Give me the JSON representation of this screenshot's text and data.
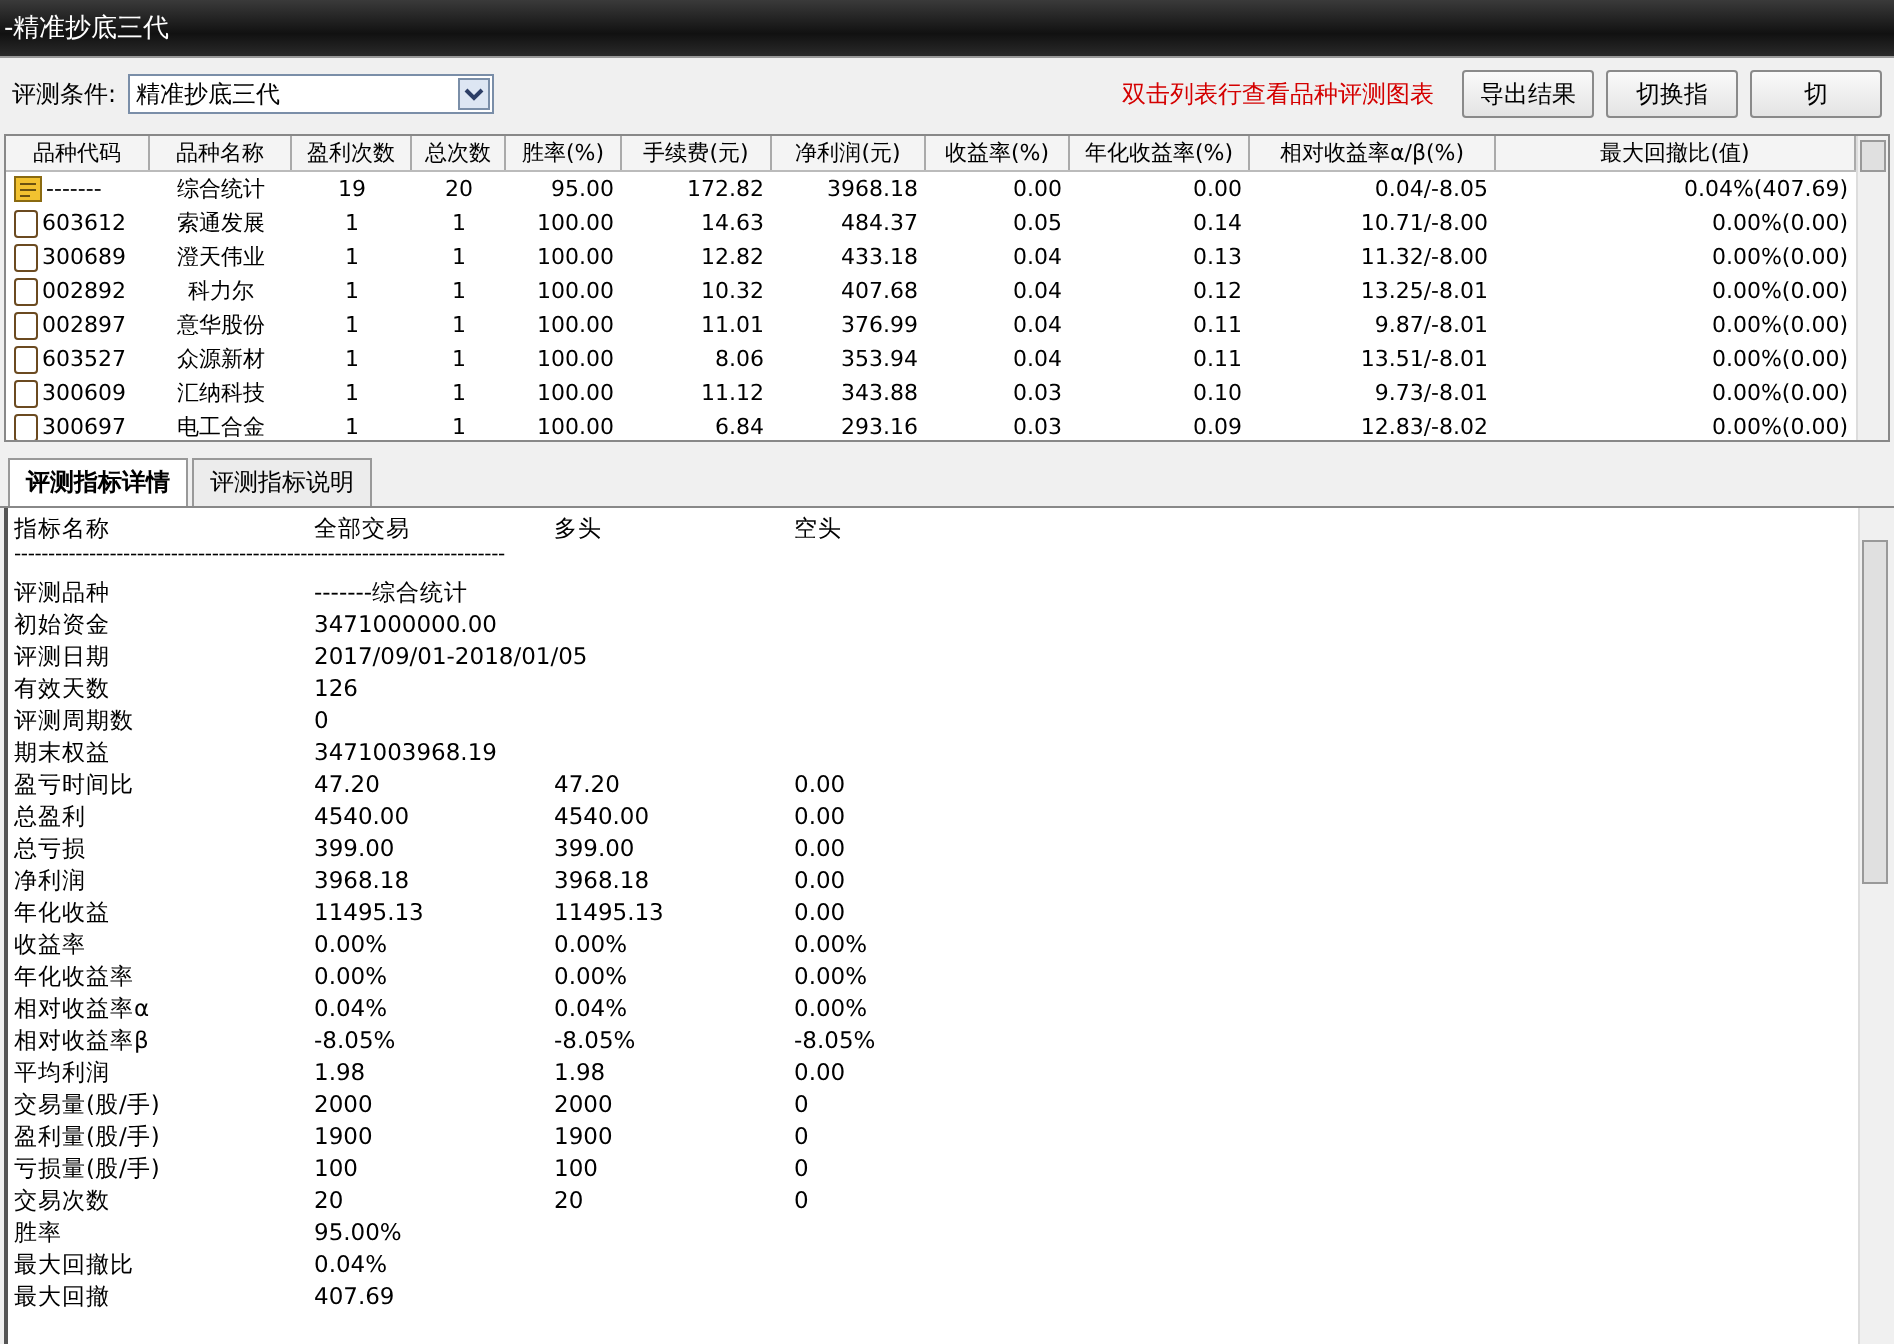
{
  "window": {
    "title": "-精准抄底三代"
  },
  "toolbar": {
    "condition_label": "评测条件:",
    "condition_value": "精准抄底三代",
    "hint": "双击列表行查看品种评测图表",
    "buttons": [
      {
        "label": "导出结果"
      },
      {
        "label": "切换指"
      },
      {
        "label": "切"
      }
    ]
  },
  "table": {
    "columns": [
      "品种代码",
      "品种名称",
      "盈利次数",
      "总次数",
      "胜率(%)",
      "手续费(元)",
      "净利润(元)",
      "收益率(%)",
      "年化收益率(%)",
      "相对收益率α/β(%)",
      "最大回撤比(值)"
    ],
    "rows": [
      {
        "kind": "summary",
        "cells": [
          "-------",
          "综合统计",
          "19",
          "20",
          "95.00",
          "172.82",
          "3968.18",
          "0.00",
          "0.00",
          "0.04/-8.05",
          "0.04%(407.69)"
        ]
      },
      {
        "kind": "item",
        "cells": [
          "603612",
          "索通发展",
          "1",
          "1",
          "100.00",
          "14.63",
          "484.37",
          "0.05",
          "0.14",
          "10.71/-8.00",
          "0.00%(0.00)"
        ]
      },
      {
        "kind": "item",
        "cells": [
          "300689",
          "澄天伟业",
          "1",
          "1",
          "100.00",
          "12.82",
          "433.18",
          "0.04",
          "0.13",
          "11.32/-8.00",
          "0.00%(0.00)"
        ]
      },
      {
        "kind": "item",
        "cells": [
          "002892",
          "科力尔",
          "1",
          "1",
          "100.00",
          "10.32",
          "407.68",
          "0.04",
          "0.12",
          "13.25/-8.01",
          "0.00%(0.00)"
        ]
      },
      {
        "kind": "item",
        "cells": [
          "002897",
          "意华股份",
          "1",
          "1",
          "100.00",
          "11.01",
          "376.99",
          "0.04",
          "0.11",
          "9.87/-8.01",
          "0.00%(0.00)"
        ]
      },
      {
        "kind": "item",
        "cells": [
          "603527",
          "众源新材",
          "1",
          "1",
          "100.00",
          "8.06",
          "353.94",
          "0.04",
          "0.11",
          "13.51/-8.01",
          "0.00%(0.00)"
        ]
      },
      {
        "kind": "item",
        "cells": [
          "300609",
          "汇纳科技",
          "1",
          "1",
          "100.00",
          "11.12",
          "343.88",
          "0.03",
          "0.10",
          "9.73/-8.01",
          "0.00%(0.00)"
        ]
      },
      {
        "kind": "item",
        "cells": [
          "300697",
          "电工合金",
          "1",
          "1",
          "100.00",
          "6.84",
          "293.16",
          "0.03",
          "0.09",
          "12.83/-8.02",
          "0.00%(0.00)"
        ]
      }
    ]
  },
  "tabs": [
    {
      "label": "评测指标详情",
      "selected": true
    },
    {
      "label": "评测指标说明",
      "selected": false
    }
  ],
  "detail": {
    "header": [
      "指标名称",
      "全部交易",
      "多头",
      "空头"
    ],
    "separator": "------------------------------------------------------------------------",
    "rows": [
      [
        "评测品种",
        "-------综合统计"
      ],
      [
        "初始资金",
        "3471000000.00"
      ],
      [
        "评测日期",
        "2017/09/01-2018/01/05"
      ],
      [
        "有效天数",
        "126"
      ],
      [
        "评测周期数",
        "0"
      ],
      [
        "期末权益",
        "3471003968.19"
      ],
      [
        "盈亏时间比",
        "47.20",
        "47.20",
        "0.00"
      ],
      [
        "总盈利",
        "4540.00",
        "4540.00",
        "0.00"
      ],
      [
        "总亏损",
        "399.00",
        "399.00",
        "0.00"
      ],
      [
        "净利润",
        "3968.18",
        "3968.18",
        "0.00"
      ],
      [
        "年化收益",
        "11495.13",
        "11495.13",
        "0.00"
      ],
      [
        "收益率",
        "0.00%",
        "0.00%",
        "0.00%"
      ],
      [
        "年化收益率",
        "0.00%",
        "0.00%",
        "0.00%"
      ],
      [
        "相对收益率α",
        "0.04%",
        "0.04%",
        "0.00%"
      ],
      [
        "相对收益率β",
        "-8.05%",
        "-8.05%",
        "-8.05%"
      ],
      [
        "平均利润",
        "1.98",
        "1.98",
        "0.00"
      ],
      [
        "交易量(股/手)",
        "2000",
        "2000",
        "0"
      ],
      [
        "盈利量(股/手)",
        "1900",
        "1900",
        "0"
      ],
      [
        "亏损量(股/手)",
        "100",
        "100",
        "0"
      ],
      [
        "交易次数",
        "20",
        "20",
        "0"
      ],
      [
        "胜率",
        "95.00%"
      ],
      [
        "最大回撤比",
        "0.04%"
      ],
      [
        "最大回撤",
        "407.69"
      ]
    ]
  }
}
